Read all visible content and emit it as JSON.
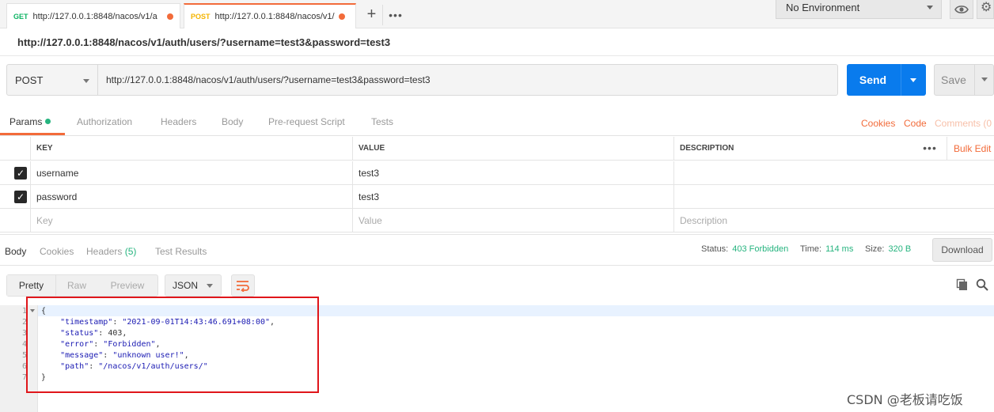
{
  "tabs": [
    {
      "method": "GET",
      "url": "http://127.0.0.1:8848/nacos/v1/a",
      "active": false
    },
    {
      "method": "POST",
      "url": "http://127.0.0.1:8848/nacos/v1/",
      "active": true
    }
  ],
  "tab_add": "+",
  "tab_more": "•••",
  "environment": "No Environment",
  "request_title": "http://127.0.0.1:8848/nacos/v1/auth/users/?username=test3&password=test3",
  "method": "POST",
  "url": "http://127.0.0.1:8848/nacos/v1/auth/users/?username=test3&password=test3",
  "send_label": "Send",
  "save_label": "Save",
  "request_tabs": {
    "params": "Params",
    "authorization": "Authorization",
    "headers": "Headers",
    "body": "Body",
    "prerequest": "Pre-request Script",
    "tests": "Tests",
    "cookies": "Cookies",
    "code": "Code",
    "comments": "Comments (0"
  },
  "params_table": {
    "headers": {
      "key": "KEY",
      "value": "VALUE",
      "description": "DESCRIPTION"
    },
    "more": "•••",
    "bulk_edit": "Bulk Edit",
    "rows": [
      {
        "checked": true,
        "key": "username",
        "value": "test3",
        "description": ""
      },
      {
        "checked": true,
        "key": "password",
        "value": "test3",
        "description": ""
      }
    ],
    "placeholder": {
      "key": "Key",
      "value": "Value",
      "description": "Description"
    }
  },
  "response_tabs": {
    "body": "Body",
    "cookies": "Cookies",
    "headers": "Headers",
    "headers_count": "(5)",
    "test_results": "Test Results"
  },
  "response_meta": {
    "status_label": "Status:",
    "status_value": "403 Forbidden",
    "time_label": "Time:",
    "time_value": "114 ms",
    "size_label": "Size:",
    "size_value": "320 B",
    "download": "Download"
  },
  "view_modes": {
    "pretty": "Pretty",
    "raw": "Raw",
    "preview": "Preview",
    "format": "JSON"
  },
  "code": {
    "open": "{",
    "close": "}",
    "lines": [
      {
        "key": "\"timestamp\"",
        "value": "\"2021-09-01T14:43:46.691+08:00\"",
        "comma": ","
      },
      {
        "key": "\"status\"",
        "value": "403",
        "comma": ","
      },
      {
        "key": "\"error\"",
        "value": "\"Forbidden\"",
        "comma": ","
      },
      {
        "key": "\"message\"",
        "value": "\"unknown user!\"",
        "comma": ","
      },
      {
        "key": "\"path\"",
        "value": "\"/nacos/v1/auth/users/\"",
        "comma": ""
      }
    ],
    "line_numbers": [
      "1",
      "2",
      "3",
      "4",
      "5",
      "6",
      "7"
    ]
  },
  "watermark": "CSDN @老板请吃饭",
  "colors": {
    "accent": "#f26b3a",
    "send": "#097bed",
    "success": "#26b47f",
    "highlight": "#e0161b"
  }
}
